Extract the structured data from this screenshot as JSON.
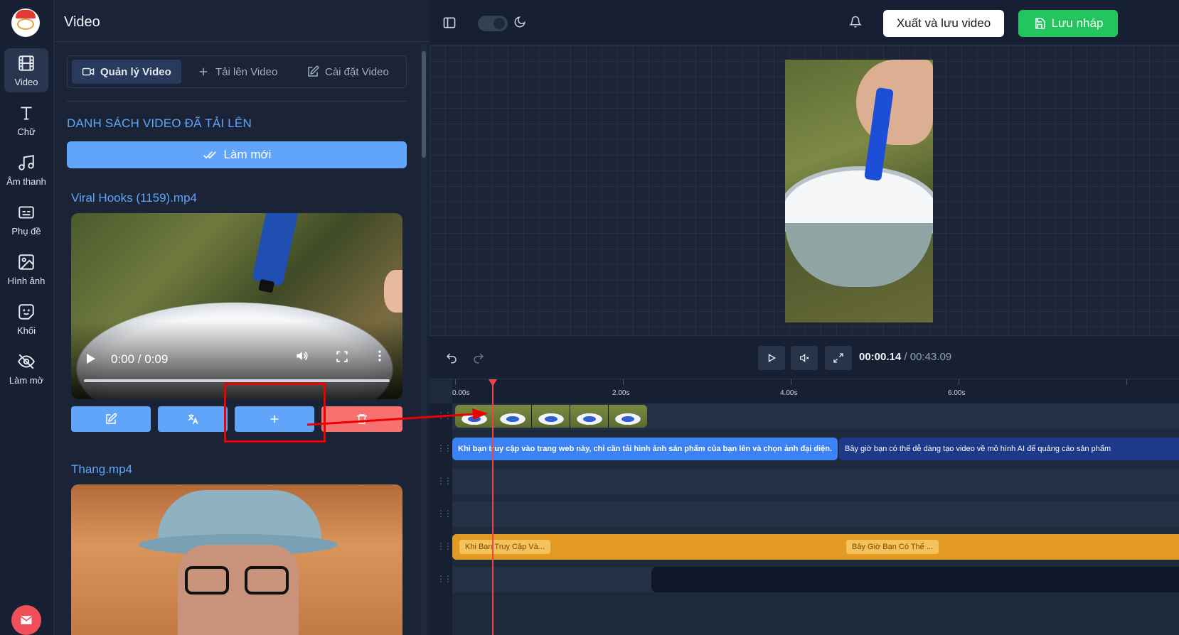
{
  "sidebar": {
    "items": [
      {
        "label": "Video",
        "icon": "film-icon",
        "active": true
      },
      {
        "label": "Chữ",
        "icon": "text-icon"
      },
      {
        "label": "Âm thanh",
        "icon": "music-note-icon"
      },
      {
        "label": "Phụ đề",
        "icon": "subtitles-icon"
      },
      {
        "label": "Hình ảnh",
        "icon": "image-icon"
      },
      {
        "label": "Khối",
        "icon": "sticker-icon"
      },
      {
        "label": "Làm mờ",
        "icon": "eye-off-icon"
      }
    ],
    "mail_icon": "mail-icon"
  },
  "panel": {
    "title": "Video",
    "tabs": [
      {
        "label": "Quản lý Video",
        "icon": "video-camera-icon",
        "active": true
      },
      {
        "label": "Tải lên Video",
        "icon": "plus-icon"
      },
      {
        "label": "Cài đặt Video",
        "icon": "edit-icon"
      }
    ],
    "section_title": "DANH SÁCH VIDEO ĐÃ TẢI LÊN",
    "refresh_label": "Làm mới",
    "videos": [
      {
        "name": "Viral Hooks (1159).mp4",
        "time": "0:00 / 0:09",
        "progress": 1.0
      },
      {
        "name": "Thang.mp4"
      }
    ],
    "actions": [
      {
        "name": "edit",
        "icon": "edit-icon",
        "color": "#60a5fa"
      },
      {
        "name": "translate",
        "icon": "translate-icon",
        "color": "#60a5fa"
      },
      {
        "name": "add-to-timeline",
        "icon": "plus-icon",
        "color": "#60a5fa"
      },
      {
        "name": "delete",
        "icon": "trash-icon",
        "color": "#f87171"
      }
    ]
  },
  "topbar": {
    "export_label": "Xuất và lưu video",
    "save_label": "Lưu nháp"
  },
  "playback": {
    "current": "00:00.14",
    "separator": "/",
    "total": "00:43.09"
  },
  "timeline": {
    "ticks": [
      "0.00s",
      "2.00s",
      "4.00s",
      "6.00s"
    ],
    "text_clips": [
      "Khi bạn truy cập vào trang web này, chỉ cần tải hình ảnh sản phẩm của bạn lên và chọn ảnh đại diện.",
      "Bây giờ bạn có thể dễ dàng tạo video về mô hình AI để quảng cáo sản phẩm"
    ],
    "audio_clips": [
      "Khi Bạn Truy Cập Và...",
      "Bây Giờ Bạn Có Thể ..."
    ]
  },
  "colors": {
    "accent": "#60a5fa",
    "save": "#22c55e",
    "delete": "#f87171",
    "audio": "#e39a22",
    "playhead": "#ef4444"
  }
}
